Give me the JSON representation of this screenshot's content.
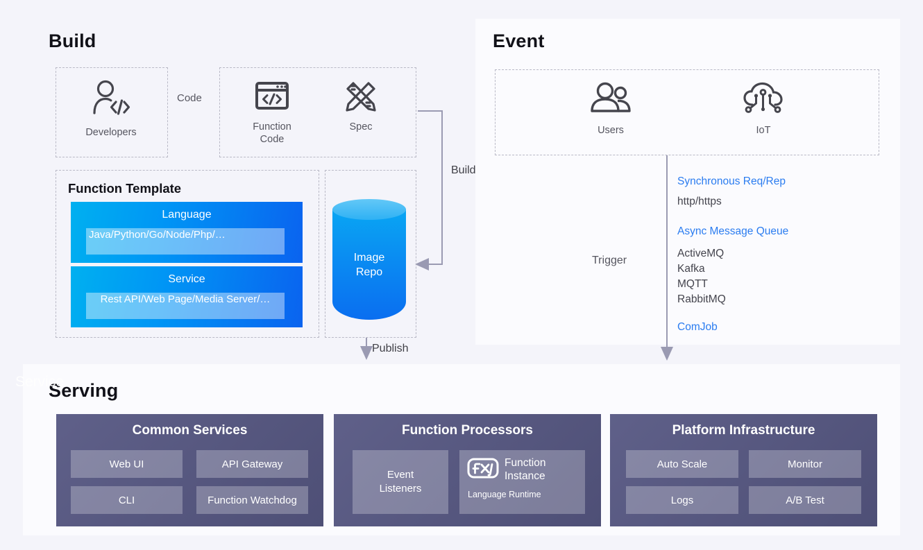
{
  "sections": {
    "build": {
      "title": "Build"
    },
    "event": {
      "title": "Event"
    },
    "serving": {
      "title": "Serving"
    }
  },
  "watermark": "Service",
  "build": {
    "developers": {
      "label": "Developers",
      "icon": "developer-code-icon"
    },
    "code_label": "Code",
    "function_code": {
      "label": "Function\nCode",
      "line1": "Function",
      "line2": "Code",
      "icon": "code-window-icon"
    },
    "spec": {
      "label": "Spec",
      "icon": "pencil-ruler-icon"
    },
    "build_label": "Build",
    "publish_label": "Publish",
    "template": {
      "title": "Function Template",
      "cards": [
        {
          "header": "Language",
          "body": "Java/Python/Go/Node/Php/…"
        },
        {
          "header": "Service",
          "body": "Rest API/Web Page/Media Server/…"
        }
      ]
    },
    "image_repo": {
      "line1": "Image",
      "line2": "Repo",
      "icon": "database-cylinder-icon"
    }
  },
  "event": {
    "sources": [
      {
        "label": "Users",
        "icon": "users-icon"
      },
      {
        "label": "IoT",
        "icon": "iot-cloud-icon"
      }
    ],
    "trigger_label": "Trigger",
    "groups": [
      {
        "title": "Synchronous Req/Rep",
        "items": [
          "http/https"
        ]
      },
      {
        "title": "Async Message Queue",
        "items": [
          "ActiveMQ",
          "Kafka",
          "MQTT",
          "RabbitMQ"
        ]
      },
      {
        "title": "ComJob",
        "items": []
      }
    ]
  },
  "serving": {
    "panels": [
      {
        "title": "Common Services",
        "chips": [
          "Web UI",
          "API Gateway",
          "CLI",
          "Function Watchdog"
        ]
      },
      {
        "title": "Function Processors",
        "event_listeners": {
          "line1": "Event",
          "line2": "Listeners"
        },
        "function_instance": {
          "line1": "Function",
          "line2": "Instance",
          "runtime": "Language Runtime",
          "icon": "fx-icon"
        }
      },
      {
        "title": "Platform Infrastructure",
        "chips": [
          "Auto Scale",
          "Monitor",
          "Logs",
          "A/B Test"
        ]
      }
    ]
  },
  "colors": {
    "page_bg": "#f4f4fa",
    "panel_bg": "#fbfbfe",
    "accent_blue": "#2a7cf0",
    "gradient_start": "#00b0f0",
    "gradient_end": "#0a63ef",
    "serving_card": "#5f6089",
    "wire": "#9a9ab2",
    "dashed_border": "#b9b9c6"
  }
}
